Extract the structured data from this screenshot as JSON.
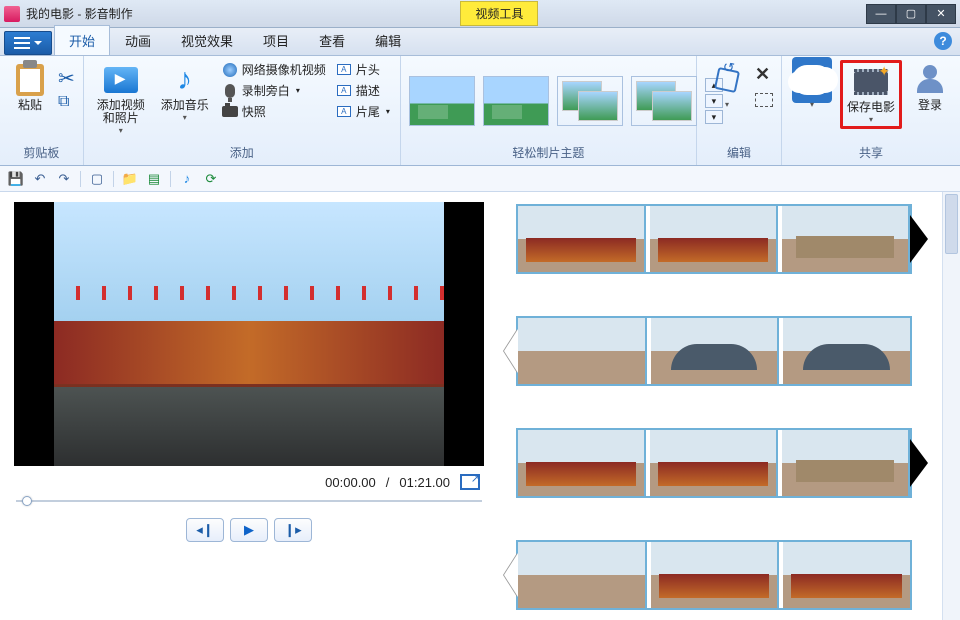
{
  "window": {
    "title": "我的电影 - 影音制作",
    "toolTab": "视频工具",
    "minimize": "—",
    "maximize": "▢",
    "close": "✕"
  },
  "tabs": {
    "file": "",
    "items": [
      "开始",
      "动画",
      "视觉效果",
      "项目",
      "查看",
      "编辑"
    ],
    "activeIndex": 0,
    "help": "?"
  },
  "ribbon": {
    "clipboard": {
      "paste": "粘贴",
      "cut": "",
      "group": "剪贴板"
    },
    "add": {
      "video": "添加视频\n和照片",
      "music": "添加音乐",
      "webcam": "网络摄像机视频",
      "narration": "录制旁白",
      "snapshot": "快照",
      "titleStart": "片头",
      "caption": "描述",
      "titleEnd": "片尾",
      "group": "添加"
    },
    "themes": {
      "group": "轻松制片主题"
    },
    "edit": {
      "rotate": "",
      "delete": "",
      "selectAll": "",
      "group": "编辑"
    },
    "share": {
      "cloud": "",
      "saveMovie": "保存电影",
      "signIn": "登录",
      "group": "共享"
    }
  },
  "qat": {
    "items": [
      "save",
      "undo",
      "redo",
      "new",
      "open-folder",
      "properties",
      "music-add",
      "refresh"
    ]
  },
  "preview": {
    "current": "00:00.00",
    "total": "01:21.00",
    "sep": "/"
  },
  "storyboard": {
    "rows": 4
  }
}
